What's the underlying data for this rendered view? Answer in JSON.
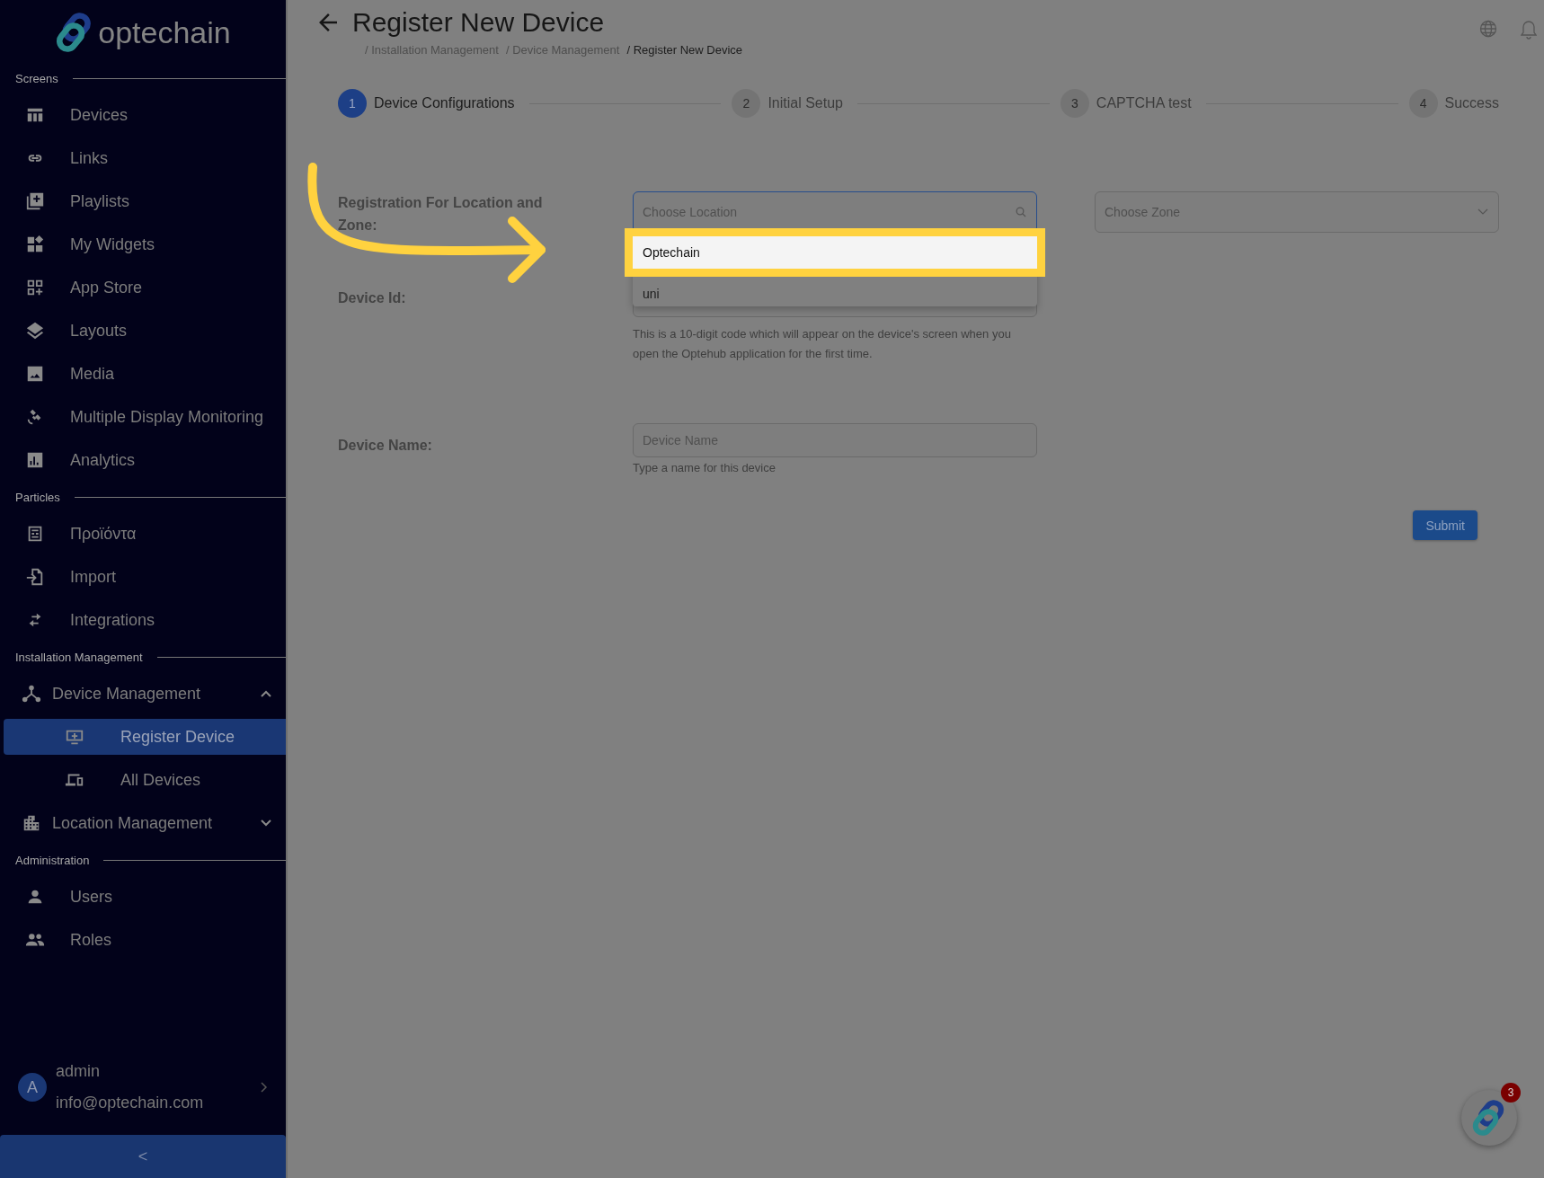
{
  "sidebar": {
    "brand": "optechain",
    "sections": [
      {
        "title": "Screens",
        "items": [
          {
            "label": "Devices",
            "selected": false
          },
          {
            "label": "Links",
            "selected": false
          },
          {
            "label": "Playlists",
            "selected": false
          },
          {
            "label": "My Widgets",
            "selected": false
          },
          {
            "label": "App Store",
            "selected": false
          },
          {
            "label": "Layouts",
            "selected": false
          },
          {
            "label": "Media",
            "selected": false
          },
          {
            "label": "Multiple Display Monitoring",
            "selected": false
          },
          {
            "label": "Analytics",
            "selected": false
          }
        ]
      },
      {
        "title": "Particles",
        "items": [
          {
            "label": "Προϊόντα",
            "selected": false
          },
          {
            "label": "Import",
            "selected": false
          },
          {
            "label": "Integrations",
            "selected": false
          }
        ]
      },
      {
        "title": "Installation Management",
        "items": [
          {
            "label": "Device Management",
            "selected": false,
            "expanded": true,
            "children": [
              {
                "label": "Register Device",
                "selected": true
              },
              {
                "label": "All Devices",
                "selected": false
              }
            ]
          },
          {
            "label": "Location Management",
            "selected": false,
            "expanded": false
          }
        ]
      },
      {
        "title": "Administration",
        "items": [
          {
            "label": "Users",
            "selected": false
          },
          {
            "label": "Roles",
            "selected": false
          }
        ]
      }
    ],
    "user": {
      "initial": "A",
      "name": "admin",
      "email": "info@optechain.com"
    },
    "collapse": "<"
  },
  "header": {
    "title": "Register New Device",
    "breadcrumb": [
      {
        "separator": "/",
        "label": "Installation Management",
        "current": false
      },
      {
        "separator": "/",
        "label": "Device Management",
        "current": false
      },
      {
        "separator": "/",
        "label": "Register New Device",
        "current": true
      }
    ]
  },
  "steps": [
    {
      "number": "1",
      "label": "Device Configurations",
      "selected": true
    },
    {
      "number": "2",
      "label": "Initial Setup",
      "selected": false
    },
    {
      "number": "3",
      "label": "CAPTCHA test",
      "selected": false
    },
    {
      "number": "4",
      "label": "Success",
      "selected": false
    }
  ],
  "form": {
    "location": {
      "label": "Registration For Location and Zone:",
      "location_placeholder": "Choose Location",
      "zone_placeholder": "Choose Zone",
      "options": [
        {
          "label": "Optechain",
          "highlighted": true
        },
        {
          "label": "uni",
          "highlighted": false
        }
      ]
    },
    "device_id": {
      "label": "Device Id:",
      "help": "This is a 10-digit code which will appear on the device's screen when you open the Optehub application for the first time."
    },
    "device_name": {
      "label": "Device Name:",
      "placeholder": "Device Name",
      "hint": "Type a name for this device"
    },
    "submit": "Submit"
  },
  "assistant": {
    "badge": "3"
  }
}
